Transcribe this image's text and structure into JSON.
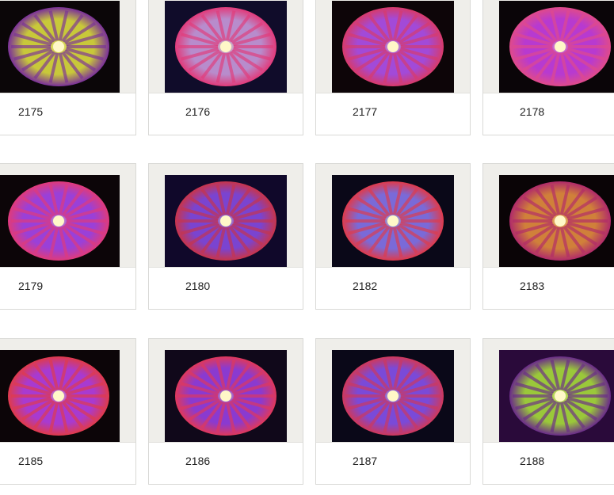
{
  "grid": {
    "items": [
      {
        "id": "2175",
        "theme": "#c8c83a",
        "accent": "#7a2f9a",
        "bg": "#0b0608"
      },
      {
        "id": "2176",
        "theme": "#b88ccc",
        "accent": "#e23a7a",
        "bg": "#100c2a"
      },
      {
        "id": "2177",
        "theme": "#a24ad8",
        "accent": "#d83a6a",
        "bg": "#0d0508"
      },
      {
        "id": "2178",
        "theme": "#b73ad0",
        "accent": "#e04a8a",
        "bg": "#0a0508"
      },
      {
        "id": "2179",
        "theme": "#9a40d8",
        "accent": "#e03a7a",
        "bg": "#0c0508"
      },
      {
        "id": "2180",
        "theme": "#7a44d0",
        "accent": "#c8344a",
        "bg": "#10082a"
      },
      {
        "id": "2182",
        "theme": "#7a6ad8",
        "accent": "#e03a4a",
        "bg": "#0a0818"
      },
      {
        "id": "2183",
        "theme": "#d0803a",
        "accent": "#b02a6a",
        "bg": "#0a0406"
      },
      {
        "id": "2185",
        "theme": "#a83ad0",
        "accent": "#e03a4a",
        "bg": "#0c0508"
      },
      {
        "id": "2186",
        "theme": "#8a3ad0",
        "accent": "#e0385a",
        "bg": "#10081a"
      },
      {
        "id": "2187",
        "theme": "#7a4ad8",
        "accent": "#d0385a",
        "bg": "#0a0818"
      },
      {
        "id": "2188",
        "theme": "#9ac83a",
        "accent": "#6a2a8a",
        "bg": "#2a0a3a"
      }
    ]
  }
}
